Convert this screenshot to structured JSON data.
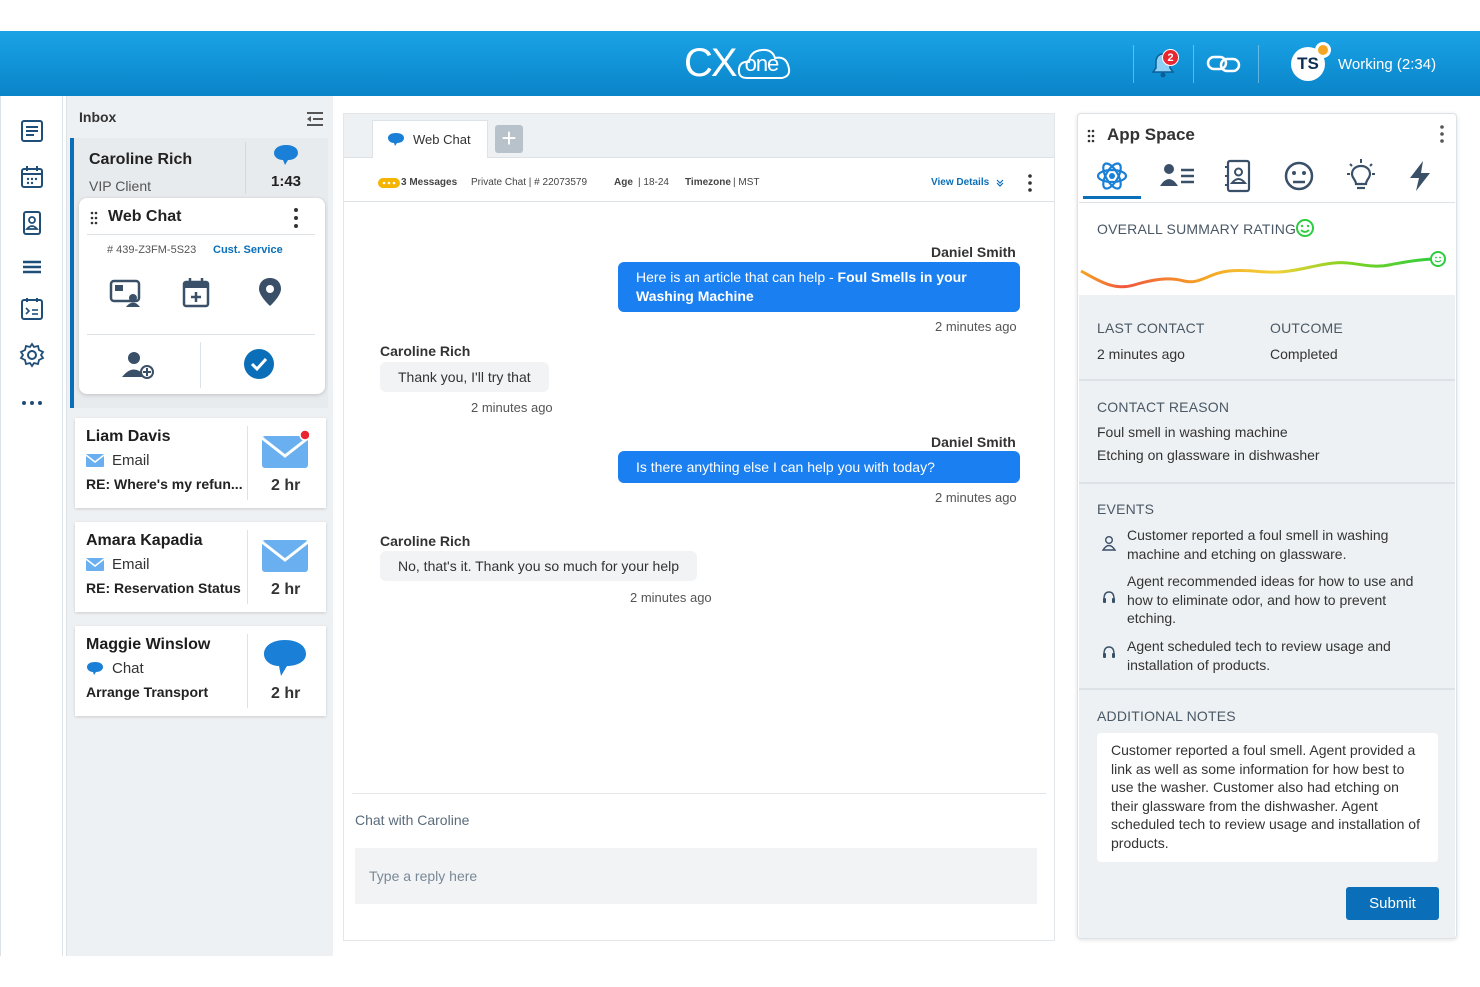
{
  "header": {
    "brand": "CX",
    "brand_suffix": "one",
    "notification_count": "2",
    "avatar_initials": "TS",
    "status": "Working (2:34)"
  },
  "inbox": {
    "title": "Inbox",
    "active": {
      "name": "Caroline Rich",
      "subtitle": "VIP Client",
      "timer": "1:43",
      "panel_title": "Web Chat",
      "case_id": "# 439-Z3FM-5S23",
      "queue": "Cust. Service"
    },
    "items": [
      {
        "name": "Liam Davis",
        "type": "Email",
        "subject": "RE: Where's my refun...",
        "time": "2 hr"
      },
      {
        "name": "Amara Kapadia",
        "type": "Email",
        "subject": "RE: Reservation Status",
        "time": "2 hr"
      },
      {
        "name": "Maggie Winslow",
        "type": "Chat",
        "subject": "Arrange Transport",
        "time": "2 hr"
      }
    ]
  },
  "chat": {
    "tab_label": "Web Chat",
    "info": {
      "messages": "3 Messages",
      "chat_type": "Private Chat | # 22073579",
      "age_label": "Age",
      "age": "| 18-24",
      "tz_label": "Timezone",
      "tz": "| MST",
      "details_link": "View Details"
    },
    "messages": [
      {
        "sender": "Daniel Smith",
        "text_plain": "Here is an article that can help - ",
        "text_bold": "Foul Smells in your Washing Machine",
        "time": "2 minutes ago"
      },
      {
        "sender": "Caroline Rich",
        "text": "Thank you, I'll try that",
        "time": "2 minutes ago"
      },
      {
        "sender": "Daniel Smith",
        "text": "Is there anything else I can help you with today?",
        "time": "2 minutes ago"
      },
      {
        "sender": "Caroline Rich",
        "text": "No, that's it.  Thank you so much for your help",
        "time": "2 minutes ago"
      }
    ],
    "chat_with": "Chat with Caroline",
    "reply_placeholder": "Type a reply here"
  },
  "app_space": {
    "title": "App Space",
    "summary_label": "OVERALL SUMMARY RATING",
    "last_contact_label": "LAST CONTACT",
    "last_contact": "2 minutes ago",
    "outcome_label": "OUTCOME",
    "outcome": "Completed",
    "contact_reason_label": "CONTACT REASON",
    "contact_reasons": [
      "Foul smell in washing machine",
      "Etching on glassware in dishwasher"
    ],
    "events_label": "EVENTS",
    "events": [
      "Customer reported a foul smell in washing machine and etching on glassware.",
      "Agent recommended ideas for how to use and how to eliminate odor, and how to prevent etching.",
      "Agent scheduled tech to review usage and installation of products."
    ],
    "notes_label": "ADDITIONAL NOTES",
    "notes": "Customer reported a foul smell. Agent provided a link as well as some information for how best to use the washer. Customer also had etching on their glassware from the dishwasher. Agent scheduled tech to review usage and installation of products.",
    "submit_label": "Submit"
  },
  "colors": {
    "header": "#0a84c9",
    "accent": "#0a6fb8",
    "bubble": "#1a7ff0",
    "badge": "#e8262f",
    "status_dot": "#f5a623",
    "rating_good": "#2ecc40"
  }
}
